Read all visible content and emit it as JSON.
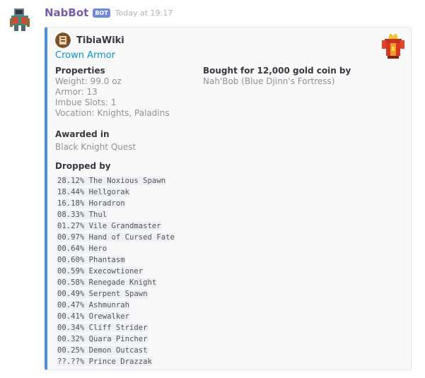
{
  "message": {
    "username": "NabBot",
    "bot_tag": "BOT",
    "timestamp": "Today at 19:17",
    "avatar_icon": "knight-sprite-icon"
  },
  "embed": {
    "accent_color": "#4a90e2",
    "author": {
      "name": "TibiaWiki",
      "icon": "tibiawiki-logo-icon"
    },
    "title": "Crown Armor",
    "thumbnail_icon": "crown-armor-icon",
    "fields": {
      "properties": {
        "name": "Properties",
        "value": "Weight: 99.0 oz\nArmor: 13\nImbue Slots: 1\nVocation: Knights, Paladins"
      },
      "bought": {
        "name": "Bought for 12,000 gold coin by",
        "value": "Nah'Bob (Blue Djinn's Fortress)"
      },
      "awarded": {
        "name": "Awarded in",
        "value": "Black Knight Quest"
      },
      "dropped": {
        "name": "Dropped by",
        "rows": [
          "28.12% The Noxious Spawn",
          "18.44% Hellgorak",
          "16.18% Horadron",
          "08.33% Thul",
          "01.27% Vile Grandmaster",
          "00.97% Hand of Cursed Fate",
          "00.64% Hero",
          "00.60% Phantasm",
          "00.59% Execowtioner",
          "00.58% Renegade Knight",
          "00.49% Serpent Spawn",
          "00.47% Ashmunrah",
          "00.41% Orewalker",
          "00.34% Cliff Strider",
          "00.32% Quara Pincher",
          "00.25% Demon Outcast",
          "??.??% Prince Drazzak"
        ]
      }
    }
  }
}
